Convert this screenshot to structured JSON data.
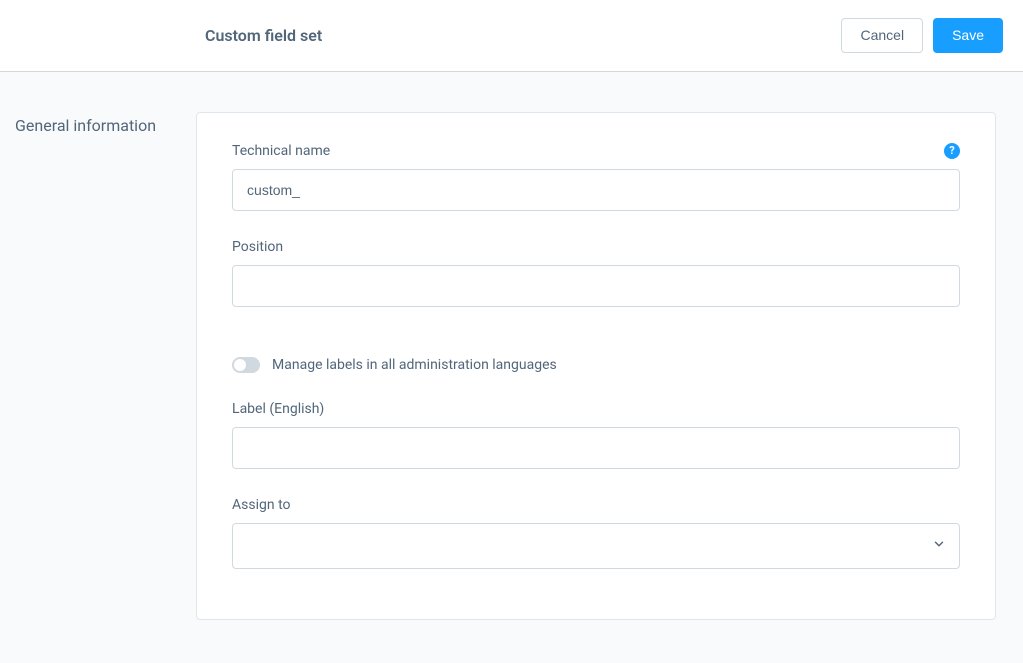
{
  "header": {
    "title": "Custom field set",
    "cancel_label": "Cancel",
    "save_label": "Save"
  },
  "section": {
    "label": "General information"
  },
  "form": {
    "technical_name": {
      "label": "Technical name",
      "value": "custom_",
      "help": "?"
    },
    "position": {
      "label": "Position",
      "value": ""
    },
    "manage_labels": {
      "label": "Manage labels in all administration languages",
      "enabled": false
    },
    "label_english": {
      "label": "Label (English)",
      "value": ""
    },
    "assign_to": {
      "label": "Assign to",
      "value": ""
    }
  }
}
